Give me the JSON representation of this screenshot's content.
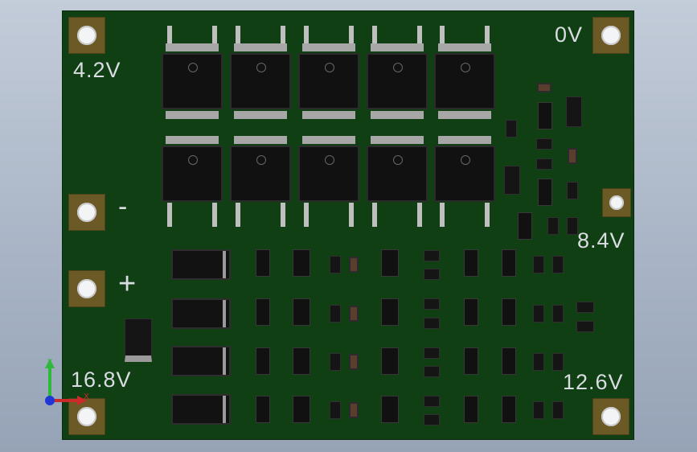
{
  "labels": {
    "v42": "4.2V",
    "v0": "0V",
    "minus": "-",
    "plus": "+",
    "v84": "8.4V",
    "v168": "16.8V",
    "v126": "12.6V"
  },
  "axes": {
    "x": "X",
    "y": "Y"
  },
  "colors": {
    "board": "#0f3f12",
    "pad": "#6b5a26",
    "background": "#b3bfd0",
    "label": "#d9dce3"
  }
}
